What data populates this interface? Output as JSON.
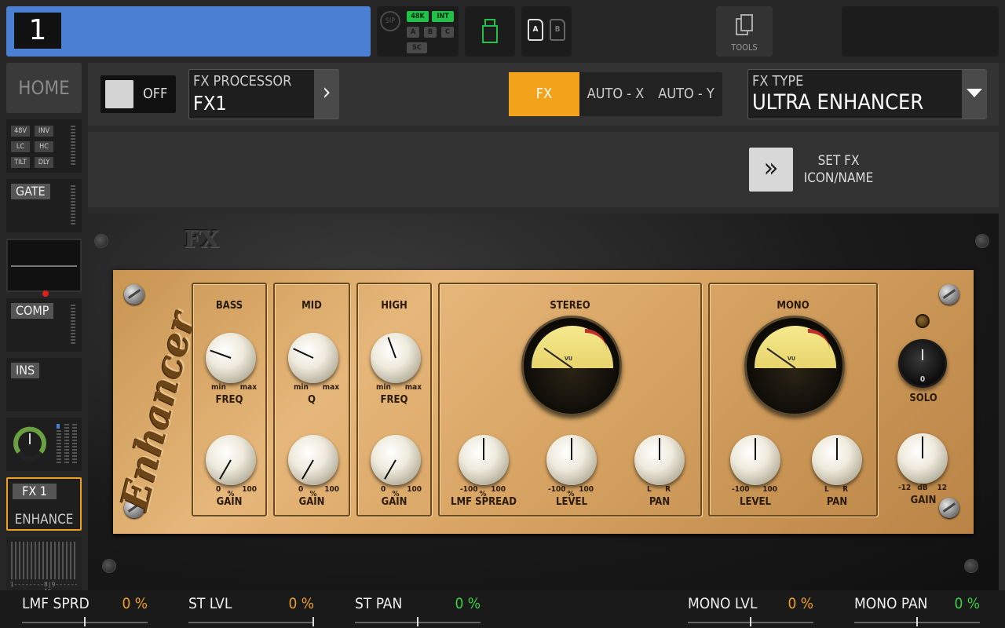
{
  "topbar": {
    "channel_number": "1",
    "status": {
      "sip": "SIP",
      "rate": "48K",
      "clock": "INT",
      "a": "A",
      "b": "B",
      "c": "C",
      "sc": "SC"
    },
    "cards": {
      "a": "A",
      "b": "B"
    },
    "tools_label": "TOOLS"
  },
  "sidebar": {
    "home": "HOME",
    "input_tags": [
      "48V",
      "INV",
      "LC",
      "HC",
      "TILT",
      "DLY"
    ],
    "gate": "GATE",
    "comp": "COMP",
    "ins": "INS",
    "fx_label": "FX 1",
    "fx_name": "ENHANCE",
    "bus_scale": "1--------8|9--------16"
  },
  "header": {
    "toggle_label": "OFF",
    "fx_processor_title": "FX PROCESSOR",
    "fx_processor_value": "FX1",
    "tabs": [
      "FX",
      "AUTO - X",
      "AUTO - Y"
    ],
    "fx_type_title": "FX TYPE",
    "fx_type_value": "ULTRA ENHANCER"
  },
  "setfx": {
    "label_line1": "SET FX",
    "label_line2": "ICON/NAME"
  },
  "rack": {
    "logo": "FX",
    "brand": "Enhancer",
    "sections": {
      "bass": {
        "title": "BASS",
        "freq_min": "min",
        "freq_max": "max",
        "freq": "FREQ",
        "gain_lo": "0",
        "gain_unit": "%",
        "gain_hi": "100",
        "gain": "GAIN"
      },
      "mid": {
        "title": "MID",
        "q_min": "min",
        "q_max": "max",
        "q": "Q",
        "gain_lo": "0",
        "gain_unit": "%",
        "gain_hi": "100",
        "gain": "GAIN"
      },
      "high": {
        "title": "HIGH",
        "freq_min": "min",
        "freq_max": "max",
        "freq": "FREQ",
        "gain_lo": "0",
        "gain_unit": "%",
        "gain_hi": "100",
        "gain": "GAIN"
      },
      "stereo": {
        "title": "STEREO",
        "spread_lo": "-100",
        "spread_unit": "%",
        "spread_hi": "100",
        "spread": "LMF SPREAD",
        "level_lo": "-100",
        "level_unit": "%",
        "level_hi": "100",
        "level": "LEVEL",
        "pan_l": "L",
        "pan_r": "R",
        "pan": "PAN",
        "vu": "VU"
      },
      "mono": {
        "title": "MONO",
        "level_lo": "-100",
        "level_hi": "100",
        "level": "LEVEL",
        "pan_l": "L",
        "pan_r": "R",
        "pan": "PAN",
        "vu": "VU"
      },
      "out": {
        "solo_scale": "0",
        "solo": "SOLO",
        "gain_lo": "-12",
        "gain_unit": "dB",
        "gain_hi": "12",
        "gain": "GAIN"
      }
    }
  },
  "bottom": [
    {
      "name": "LMF SPRD",
      "value": "0 %",
      "color": "#f0a020",
      "level": 0.5
    },
    {
      "name": "ST LVL",
      "value": "0 %",
      "color": "#f0a020",
      "level": 1.0
    },
    {
      "name": "ST PAN",
      "value": "0 %",
      "color": "#3ad040",
      "level": 0.5
    },
    {
      "name": "MONO LVL",
      "value": "0 %",
      "color": "#f0a020",
      "level": 0.5
    },
    {
      "name": "MONO PAN",
      "value": "0 %",
      "color": "#3ad040",
      "level": 0.5
    }
  ],
  "colors": {
    "accent": "#f3a21b",
    "channel": "#4a7fd4",
    "status_on": "#22c24a"
  }
}
